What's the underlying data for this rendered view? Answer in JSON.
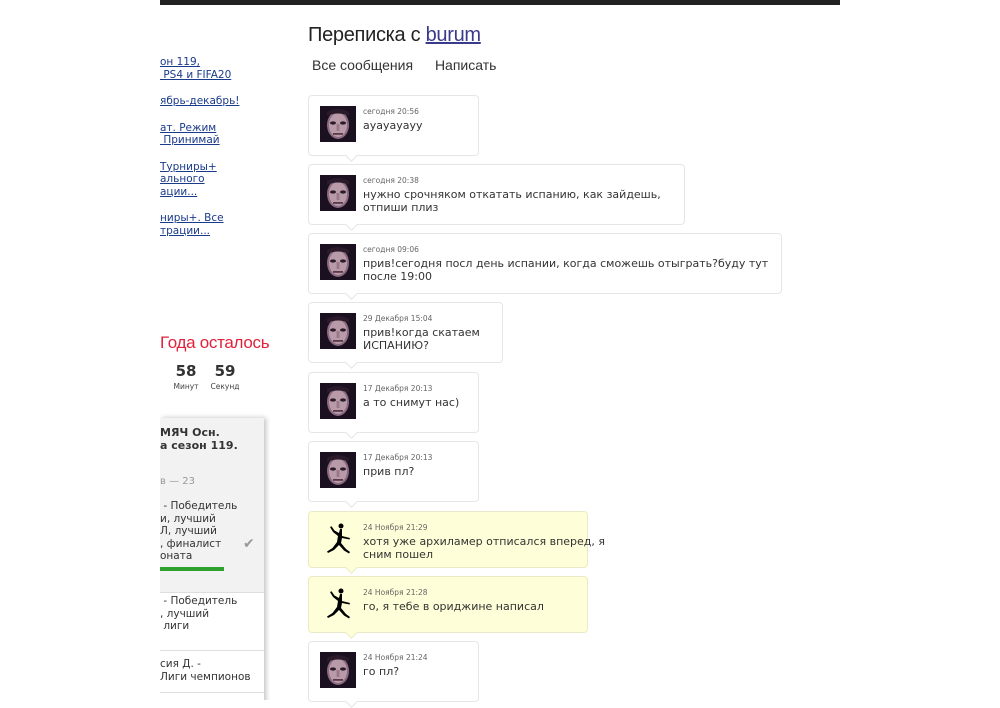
{
  "sidebar": {
    "links": [
      "он 119,\n PS4 и FIFA20",
      "ябрь-декабрь!",
      "ат. Режим\n Принимай",
      "Турниры+\nального\nации...",
      "ниры+. Все\nтрации..."
    ],
    "countdown_title": "Года осталось",
    "countdown": [
      {
        "value": "58",
        "label": "Минут"
      },
      {
        "value": "59",
        "label": "Секунд"
      }
    ],
    "poll": {
      "title": "МЯЧ Осн.\nа сезон 119.",
      "subtitle": "в — 23",
      "option1": " - Победитель\nи, лучший\nЛ, лучший\n, финалист\nоната",
      "option2": " - Победитель\n, лучший\n лиги",
      "option3": "сия Д. -\nЛиги чемпионов"
    }
  },
  "header": {
    "title_prefix": "Переписка с ",
    "user": "burum",
    "tabs": [
      "Все сообщения",
      "Написать"
    ]
  },
  "messages": [
    {
      "date": "сегодня 20:56",
      "text": "ayayayayy",
      "avatar": "face"
    },
    {
      "date": "сегодня 20:38",
      "text": "нужно срочняком откатать испанию, как зайдешь,\nотпиши плиз",
      "avatar": "face"
    },
    {
      "date": "сегодня 09:06",
      "text": "прив!сегодня посл день испании, когда сможешь отыграть?буду тут\nпосле 19:00",
      "avatar": "face"
    },
    {
      "date": "29 Декабря 15:04",
      "text": "прив!когда скатаем\nИСПАНИЮ?",
      "avatar": "face"
    },
    {
      "date": "17 Декабря 20:13",
      "text": "а то снимут нас)",
      "avatar": "face"
    },
    {
      "date": "17 Декабря 20:13",
      "text": "прив пл?",
      "avatar": "face"
    },
    {
      "date": "24 Ноября 21:29",
      "text": "хотя уже архиламер отписался вперед, я\nсним пошел",
      "avatar": "jumpman"
    },
    {
      "date": "24 Ноября 21:28",
      "text": "го, я тебе в ориджине написал",
      "avatar": "jumpman"
    },
    {
      "date": "24 Ноября 21:24",
      "text": "го пл?",
      "avatar": "face"
    }
  ],
  "colors": {
    "countdown_title": "#e0223a",
    "link": "#1a3a8a",
    "user_link": "#3a3a8a",
    "own_message_bg": "#fefed8",
    "poll_bar": "#2ea02e"
  },
  "icons": {
    "face": "user-avatar-icon",
    "jumpman": "jumpman-logo-icon",
    "check": "checkmark-icon"
  }
}
